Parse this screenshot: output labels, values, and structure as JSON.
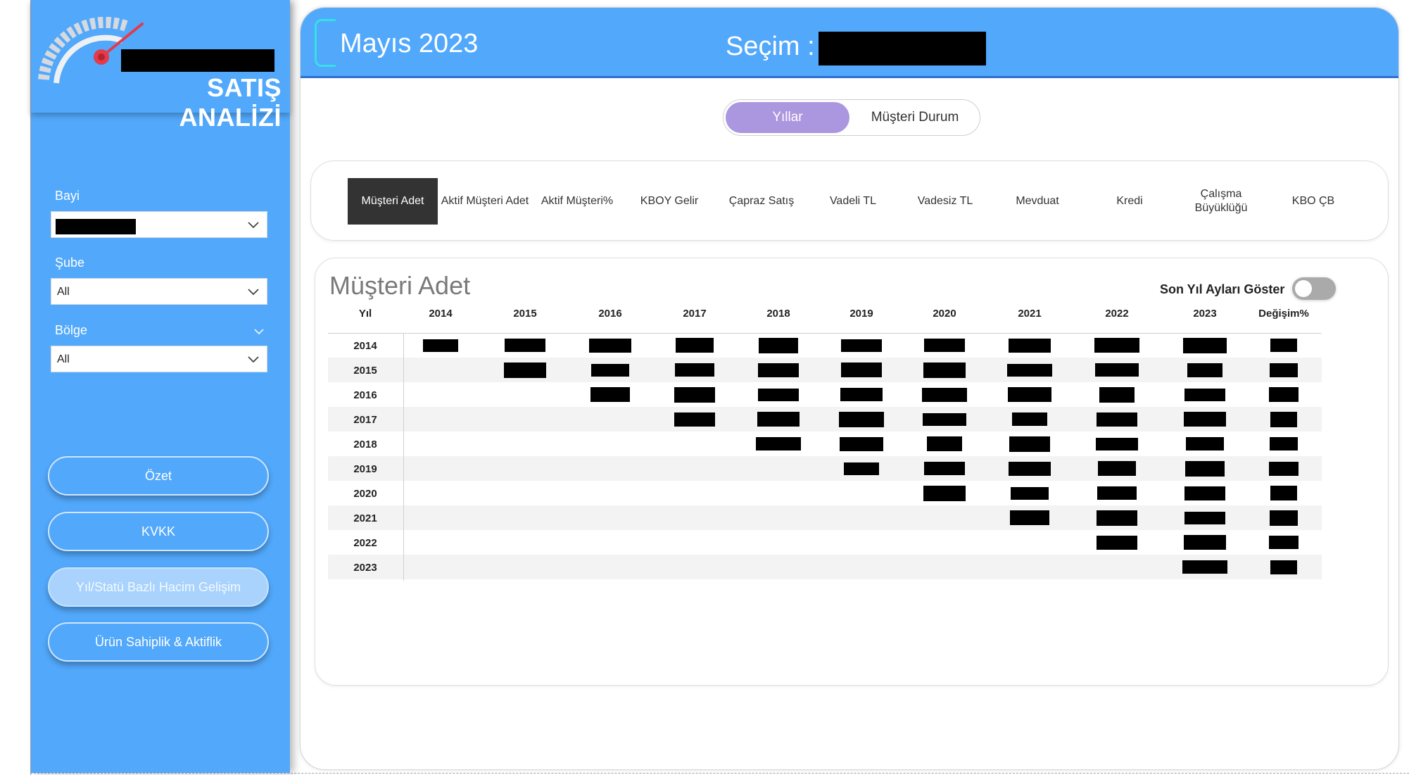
{
  "sidebar": {
    "logo_title": "SATIŞ ANALİZİ",
    "filters": {
      "bayi_label": "Bayi",
      "sube_label": "Şube",
      "sube_value": "All",
      "bolge_label": "Bölge",
      "bolge_value": "All"
    },
    "nav": {
      "ozet": "Özet",
      "kvkk": "KVKK",
      "yil_statu": "Yıl/Statü Bazlı Hacim Gelişim",
      "urun": "Ürün Sahiplik & Aktiflik"
    }
  },
  "header": {
    "date": "Mayıs 2023",
    "secim_label": "Seçim :"
  },
  "toggle": {
    "option_years": "Yıllar",
    "option_customer": "Müşteri Durum"
  },
  "tabs": [
    "Müşteri Adet",
    "Aktif Müşteri Adet",
    "Aktif Müşteri%",
    "KBOY Gelir",
    "Çapraz Satış",
    "Vadeli TL",
    "Vadesiz TL",
    "Mevduat",
    "Kredi",
    "Çalışma Büyüklüğü",
    "KBO ÇB"
  ],
  "table": {
    "title": "Müşteri Adet",
    "switch_label": "Son Yıl Ayları Göster",
    "corner_header": "Yıl",
    "column_headers": [
      "2014",
      "2015",
      "2016",
      "2017",
      "2018",
      "2019",
      "2020",
      "2021",
      "2022",
      "2023"
    ],
    "change_header": "Değişim%",
    "row_labels": [
      "2014",
      "2015",
      "2016",
      "2017",
      "2018",
      "2019",
      "2020",
      "2021",
      "2022",
      "2023"
    ]
  },
  "colors": {
    "sidebar_blue": "#52a8fb",
    "active_toggle": "#ab96e0",
    "active_tab": "#333333",
    "header_bracket": "#35e0e6"
  }
}
